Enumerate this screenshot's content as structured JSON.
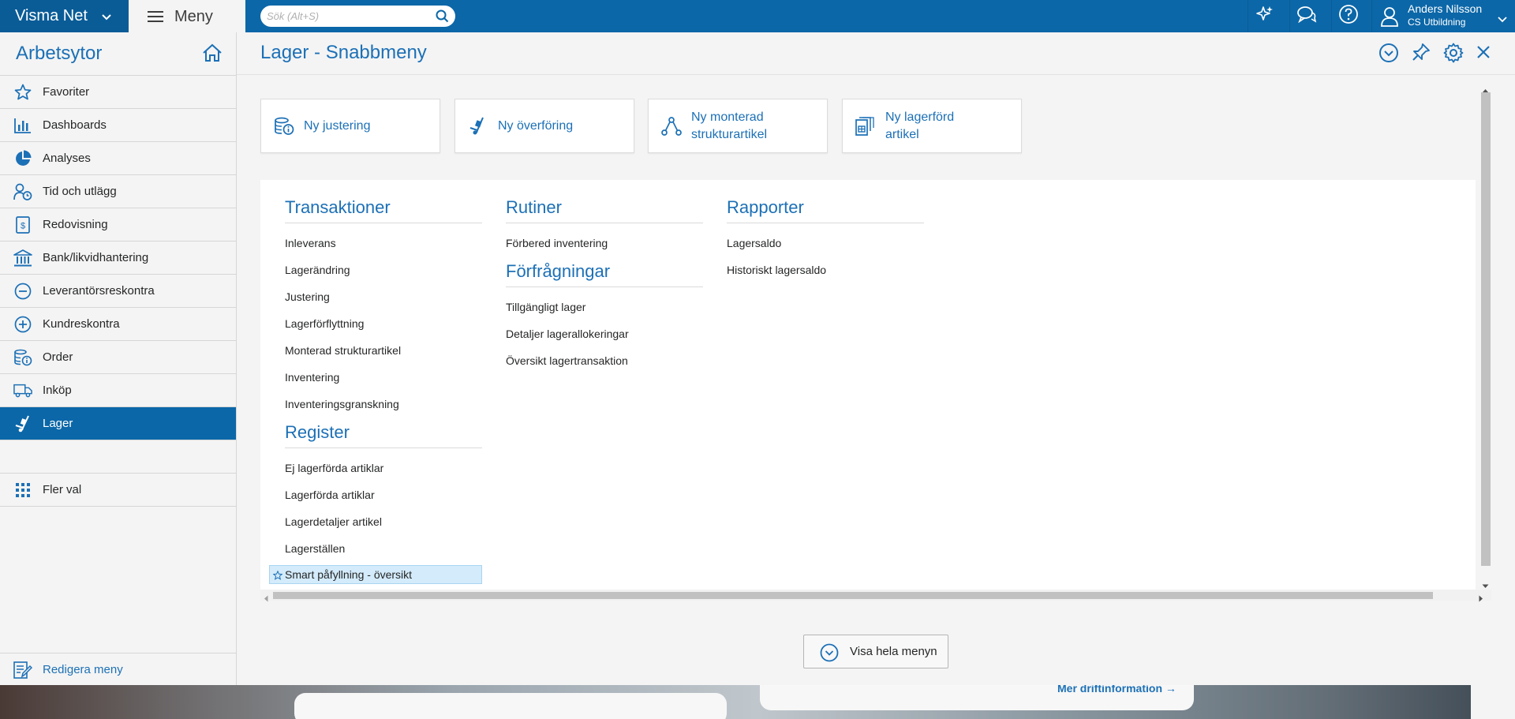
{
  "topbar": {
    "brand": "Visma Net",
    "menu_label": "Meny",
    "search_placeholder": "Sök (Alt+S)",
    "user_name": "Anders Nilsson",
    "user_company": "CS Utbildning"
  },
  "sidebar": {
    "title": "Arbetsytor",
    "items": [
      {
        "label": "Favoriter"
      },
      {
        "label": "Dashboards"
      },
      {
        "label": "Analyses"
      },
      {
        "label": "Tid och utlägg"
      },
      {
        "label": "Redovisning"
      },
      {
        "label": "Bank/likvidhantering"
      },
      {
        "label": "Leverantörsreskontra"
      },
      {
        "label": "Kundreskontra"
      },
      {
        "label": "Order"
      },
      {
        "label": "Inköp"
      },
      {
        "label": "Lager"
      }
    ],
    "more_label": "Fler val",
    "edit_menu_label": "Redigera meny"
  },
  "main": {
    "title": "Lager - Snabbmeny",
    "tiles": [
      {
        "label": "Ny justering"
      },
      {
        "label": "Ny överföring"
      },
      {
        "label_line1": "Ny monterad",
        "label_line2": "strukturartikel"
      },
      {
        "label_line1": "Ny lagerförd",
        "label_line2": "artikel"
      }
    ],
    "sections": {
      "transaktioner": {
        "title": "Transaktioner",
        "links": [
          "Inleverans",
          "Lagerändring",
          "Justering",
          "Lagerförflyttning",
          "Monterad strukturartikel",
          "Inventering",
          "Inventeringsgranskning"
        ]
      },
      "register": {
        "title": "Register",
        "links": [
          "Ej lagerförda artiklar",
          "Lagerförda artiklar",
          "Lagerdetaljer artikel",
          "Lagerställen",
          "Smart påfyllning - översikt"
        ]
      },
      "rutiner": {
        "title": "Rutiner",
        "links": [
          "Förbered inventering"
        ]
      },
      "forfragningar": {
        "title": "Förfrågningar",
        "links": [
          "Tillgängligt lager",
          "Detaljer lagerallokeringar",
          "Översikt lagertransaktion"
        ]
      },
      "rapporter": {
        "title": "Rapporter",
        "links": [
          "Lagersaldo",
          "Historiskt lagersaldo"
        ]
      }
    },
    "show_all_label": "Visa hela menyn"
  },
  "background": {
    "link_text": "Mer driftinformation →"
  },
  "colors": {
    "brand_blue": "#0b67a8",
    "accent_blue": "#1c70b6",
    "highlight": "#d3ebfb"
  }
}
